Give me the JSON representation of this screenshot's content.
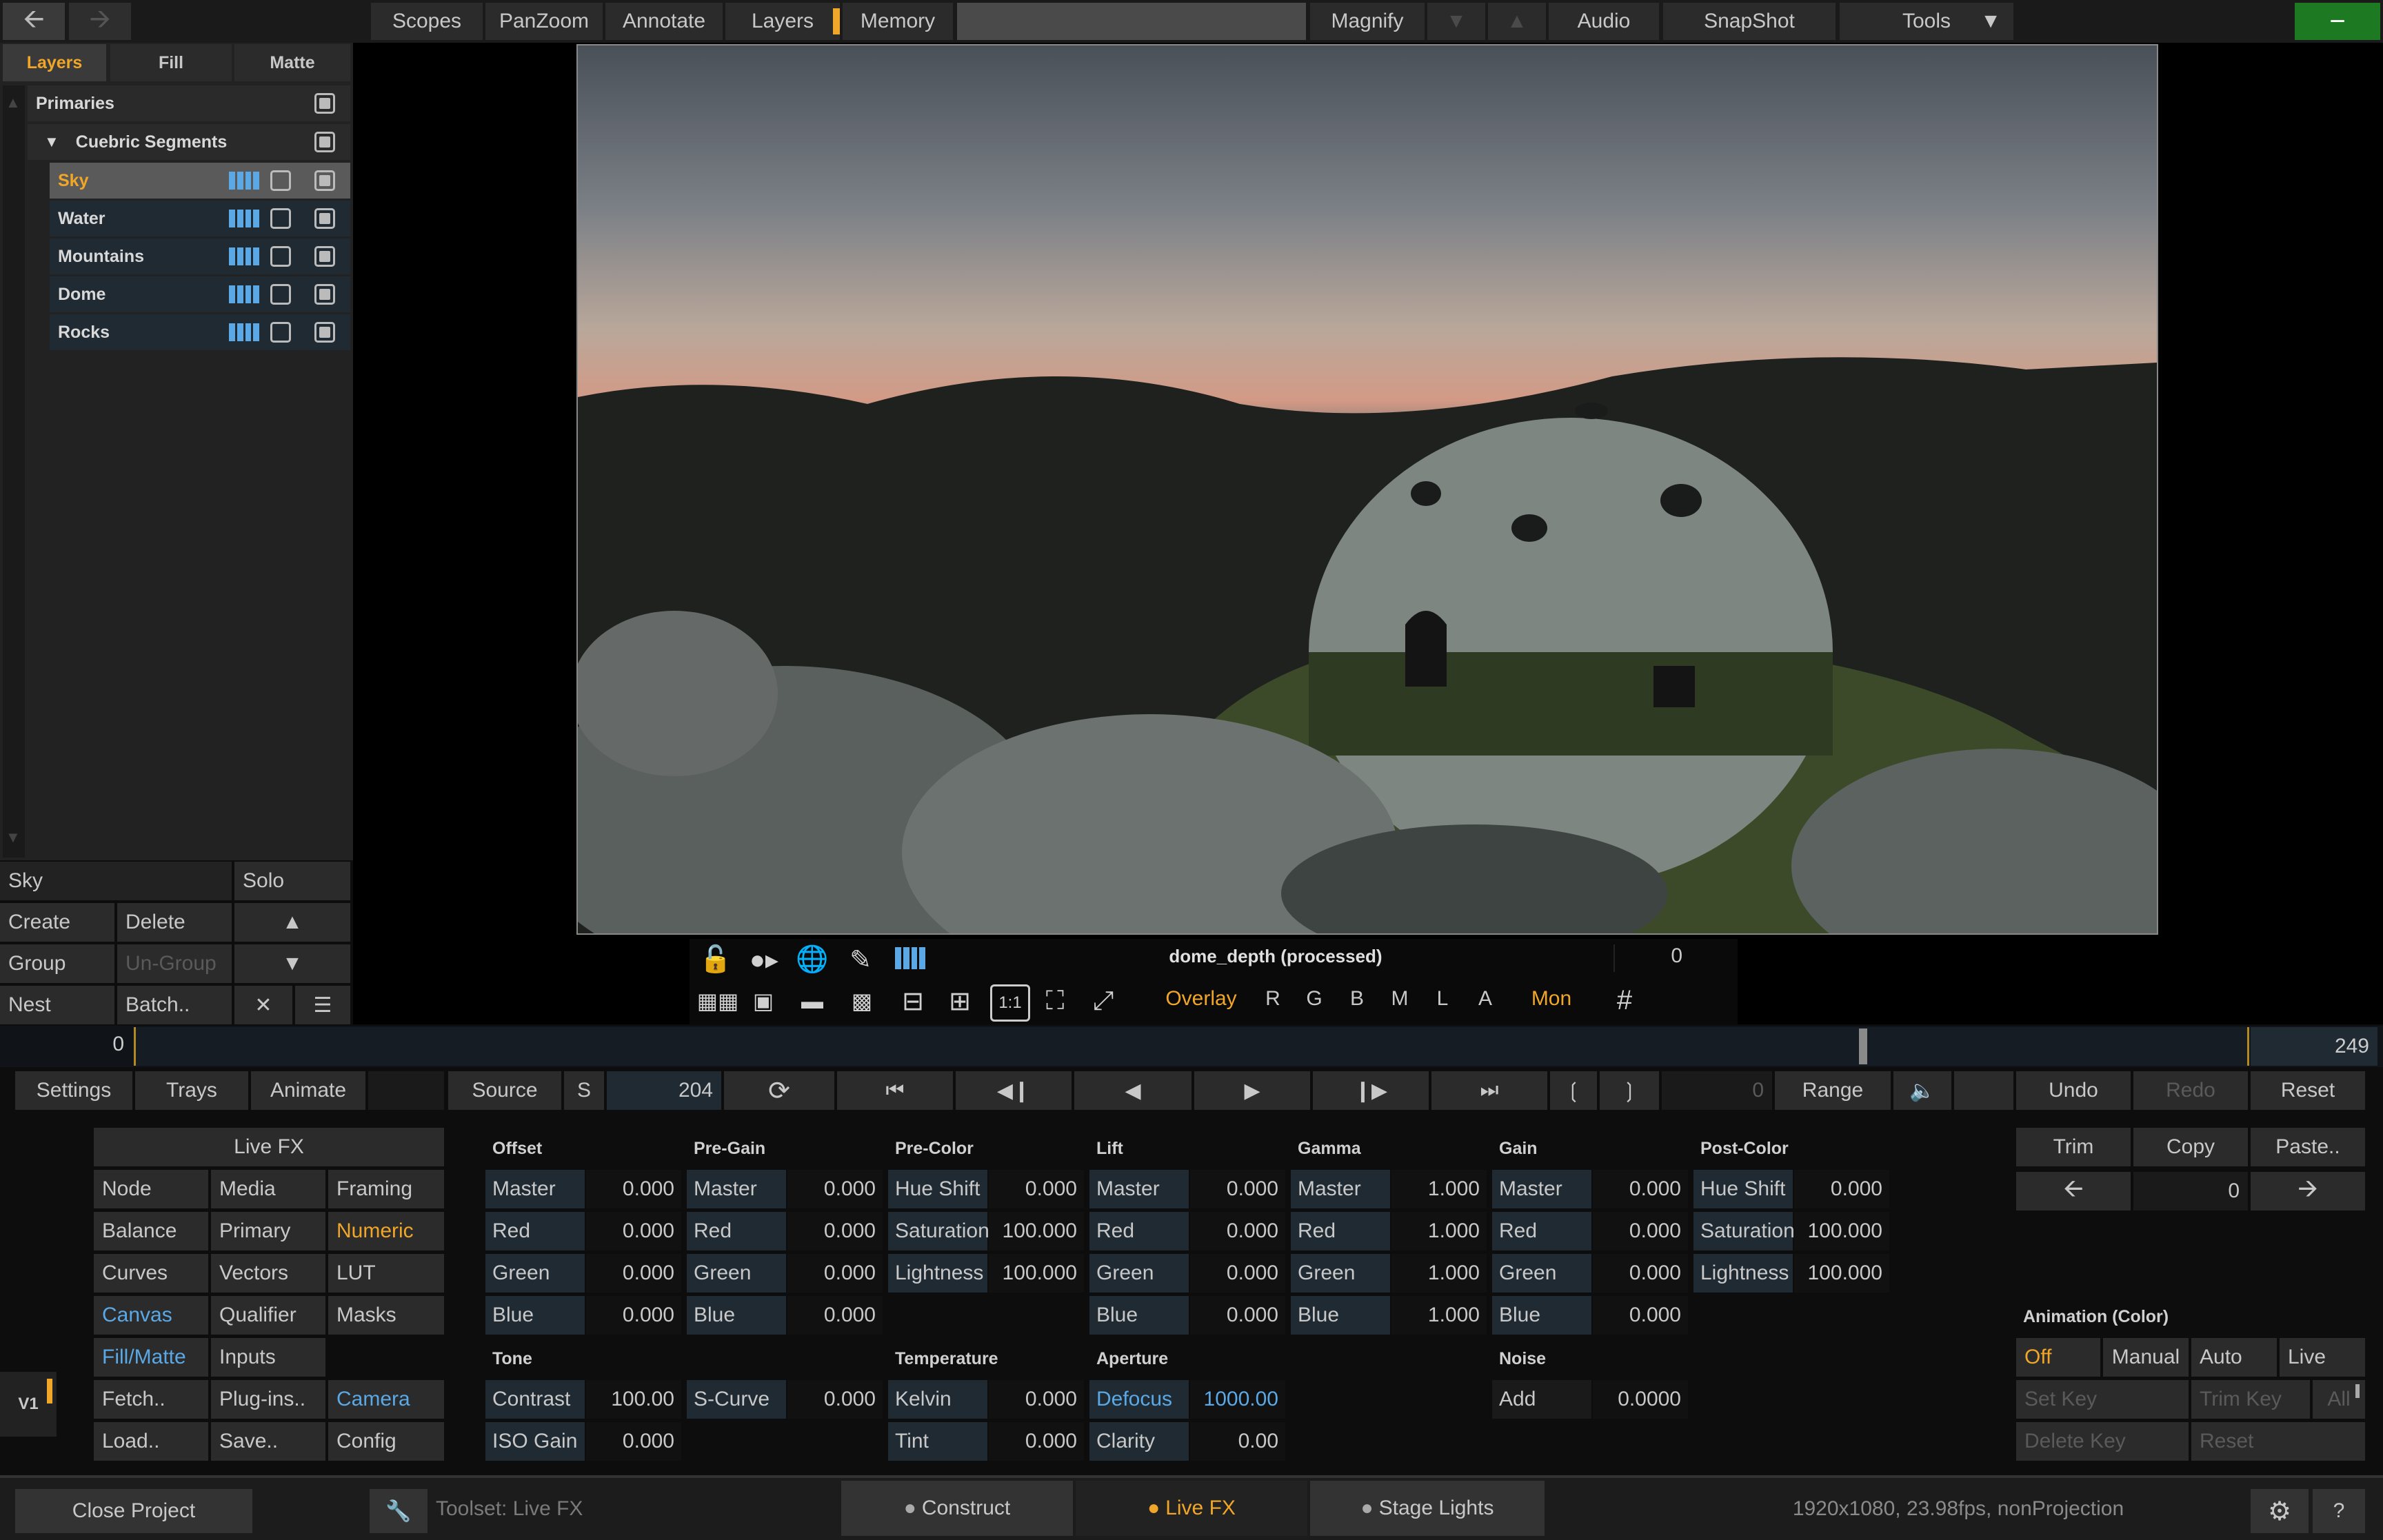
{
  "top_menu": {
    "scopes": "Scopes",
    "panzoom": "PanZoom",
    "annotate": "Annotate",
    "layers": "Layers",
    "memory": "Memory",
    "magnify": "Magnify",
    "audio": "Audio",
    "snapshot": "SnapShot",
    "tools": "Tools"
  },
  "layers_panel": {
    "tabs": [
      "Layers",
      "Fill",
      "Matte"
    ],
    "root": "Primaries",
    "group": "Cuebric Segments",
    "items": [
      "Sky",
      "Water",
      "Mountains",
      "Dome",
      "Rocks"
    ],
    "selected_name": "Sky",
    "solo": "Solo",
    "create": "Create",
    "delete": "Delete",
    "group_btn": "Group",
    "ungroup": "Un-Group",
    "nest": "Nest",
    "batch": "Batch.."
  },
  "viewer": {
    "clip_name": "dome_depth (processed)",
    "frame_display": "0",
    "overlay": "Overlay",
    "channels": [
      "R",
      "G",
      "B",
      "M",
      "L",
      "A"
    ],
    "mon": "Mon",
    "zoom_1to1": "1:1"
  },
  "timeline": {
    "start": "0",
    "end": "249",
    "playhead_fraction": 0.82
  },
  "transport": {
    "settings": "Settings",
    "trays": "Trays",
    "animate": "Animate",
    "source": "Source",
    "s": "S",
    "frame": "204",
    "range_value": "0",
    "range": "Range",
    "undo": "Undo",
    "redo": "Redo",
    "reset": "Reset"
  },
  "livefx_menu": {
    "title": "Live FX",
    "rows": [
      [
        "Node",
        "Media",
        "Framing"
      ],
      [
        "Balance",
        "Primary",
        "Numeric"
      ],
      [
        "Curves",
        "Vectors",
        "LUT"
      ],
      [
        "Canvas",
        "Qualifier",
        "Masks"
      ],
      [
        "Fill/Matte",
        "Inputs",
        ""
      ],
      [
        "Fetch..",
        "Plug-ins..",
        "Camera"
      ],
      [
        "Load..",
        "Save..",
        "Config"
      ]
    ]
  },
  "v1": "V1",
  "params": {
    "offset": {
      "title": "Offset",
      "rows": [
        [
          "Master",
          "0.000"
        ],
        [
          "Red",
          "0.000"
        ],
        [
          "Green",
          "0.000"
        ],
        [
          "Blue",
          "0.000"
        ]
      ]
    },
    "pregain": {
      "title": "Pre-Gain",
      "rows": [
        [
          "Master",
          "0.000"
        ],
        [
          "Red",
          "0.000"
        ],
        [
          "Green",
          "0.000"
        ],
        [
          "Blue",
          "0.000"
        ]
      ]
    },
    "precolor": {
      "title": "Pre-Color",
      "rows": [
        [
          "Hue Shift",
          "0.000"
        ],
        [
          "Saturation",
          "100.000"
        ],
        [
          "Lightness",
          "100.000"
        ]
      ]
    },
    "lift": {
      "title": "Lift",
      "rows": [
        [
          "Master",
          "0.000"
        ],
        [
          "Red",
          "0.000"
        ],
        [
          "Green",
          "0.000"
        ],
        [
          "Blue",
          "0.000"
        ]
      ]
    },
    "gamma": {
      "title": "Gamma",
      "rows": [
        [
          "Master",
          "1.000"
        ],
        [
          "Red",
          "1.000"
        ],
        [
          "Green",
          "1.000"
        ],
        [
          "Blue",
          "1.000"
        ]
      ]
    },
    "gain": {
      "title": "Gain",
      "rows": [
        [
          "Master",
          "0.000"
        ],
        [
          "Red",
          "0.000"
        ],
        [
          "Green",
          "0.000"
        ],
        [
          "Blue",
          "0.000"
        ]
      ]
    },
    "postcolor": {
      "title": "Post-Color",
      "rows": [
        [
          "Hue Shift",
          "0.000"
        ],
        [
          "Saturation",
          "100.000"
        ],
        [
          "Lightness",
          "100.000"
        ]
      ]
    },
    "tone": {
      "title": "Tone",
      "contrast": "Contrast",
      "contrast_val": "100.00",
      "scurve": "S-Curve",
      "scurve_val": "0.000",
      "iso": "ISO Gain",
      "iso_val": "0.000"
    },
    "temperature": {
      "title": "Temperature",
      "kelvin": "Kelvin",
      "kelvin_val": "0.000",
      "tint": "Tint",
      "tint_val": "0.000"
    },
    "aperture": {
      "title": "Aperture",
      "defocus": "Defocus",
      "defocus_val": "1000.00",
      "clarity": "Clarity",
      "clarity_val": "0.00"
    },
    "noise": {
      "title": "Noise",
      "add": "Add",
      "add_val": "0.0000"
    }
  },
  "right_panel": {
    "trim": "Trim",
    "copy": "Copy",
    "paste": "Paste..",
    "value": "0",
    "anim_title": "Animation (Color)",
    "off": "Off",
    "manual": "Manual",
    "auto": "Auto",
    "live": "Live",
    "set_key": "Set Key",
    "trim_key": "Trim Key",
    "all": "All",
    "delete_key": "Delete Key",
    "reset": "Reset"
  },
  "bottom_bar": {
    "close": "Close Project",
    "toolset": "Toolset: Live FX",
    "tabs": [
      "Construct",
      "Live FX",
      "Stage Lights"
    ],
    "info": "1920x1080, 23.98fps, nonProjection",
    "help": "?"
  },
  "colors": {
    "accent": "#f0a628",
    "link": "#5aa9e6",
    "panel": "#2b2b2b",
    "label_cell": "#1f2a33",
    "green_button": "#1e7a22"
  }
}
